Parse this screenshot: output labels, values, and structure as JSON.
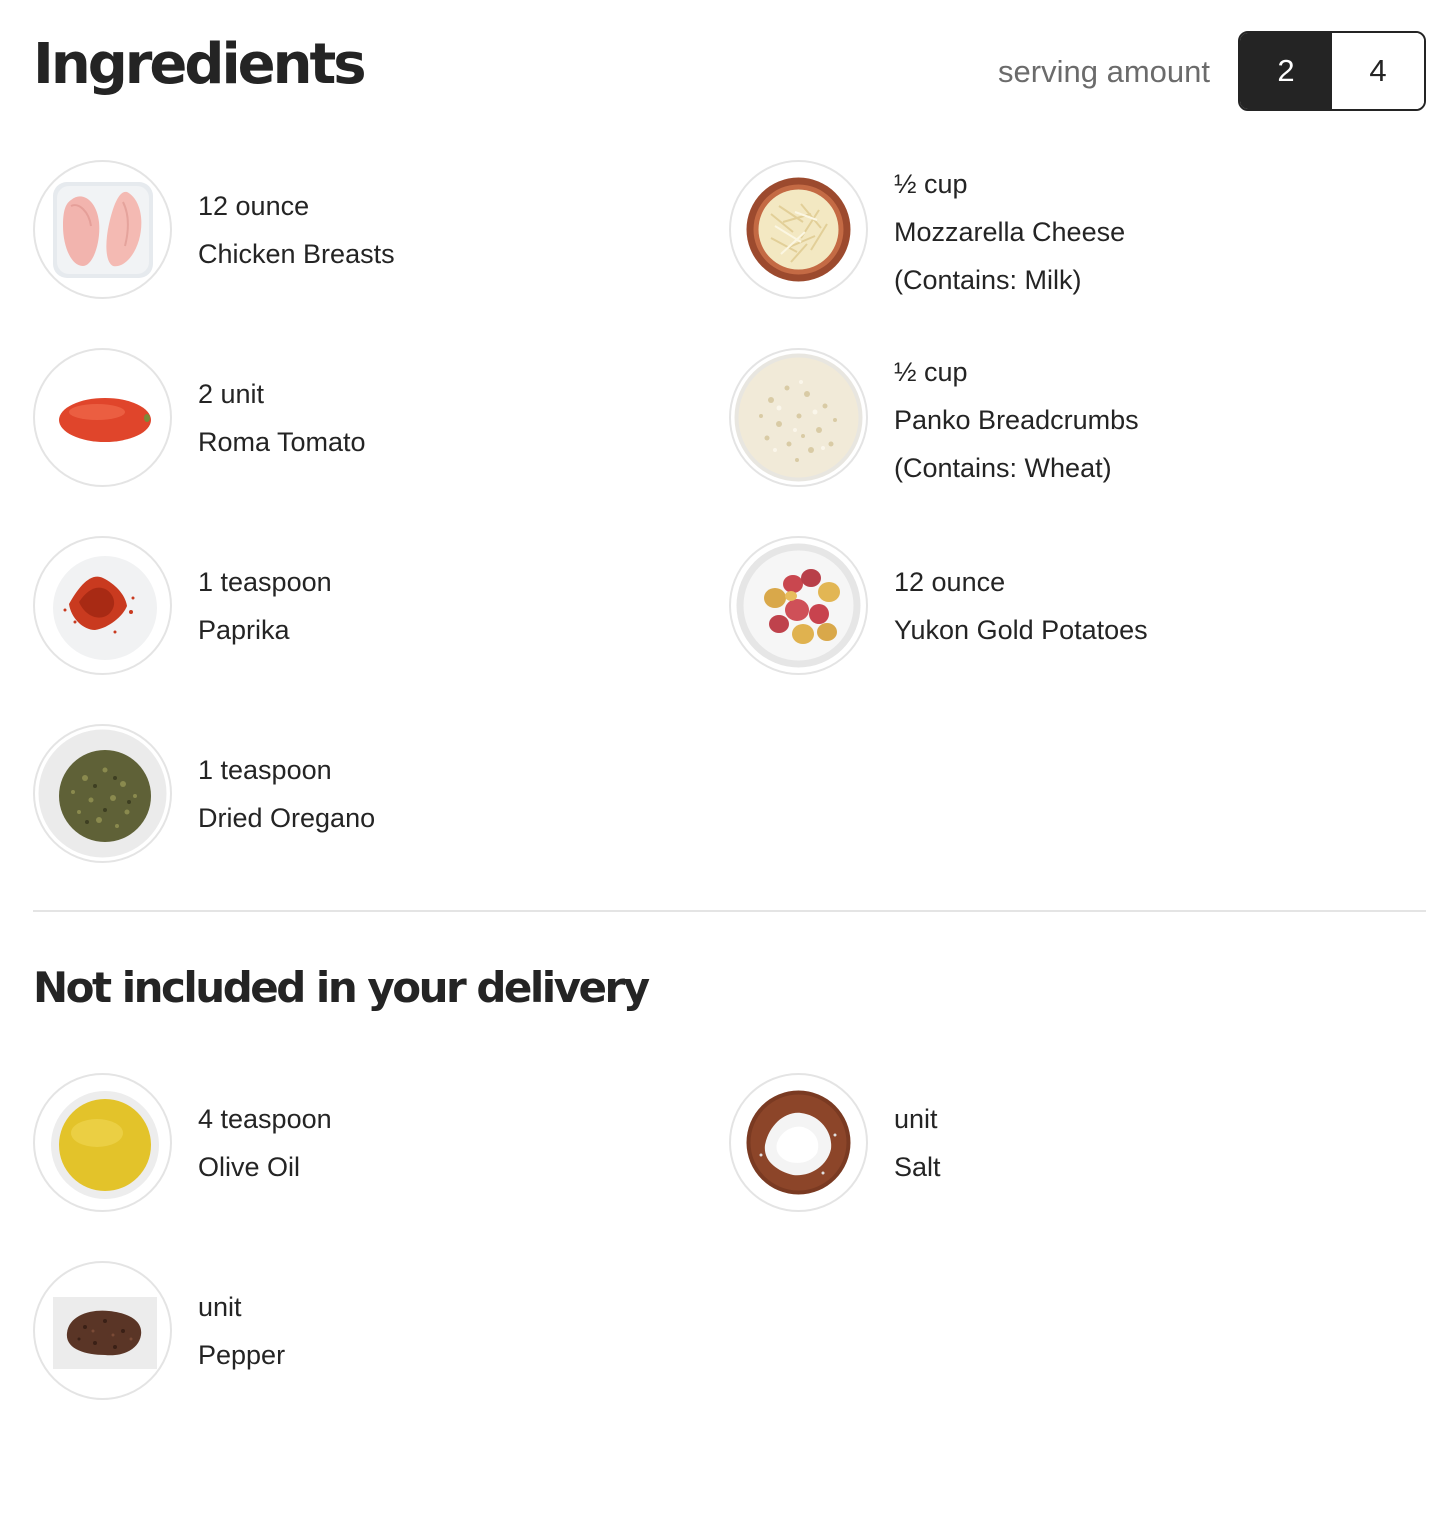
{
  "header": {
    "title": "Ingredients",
    "serving_label": "serving amount",
    "serving_options": [
      "2",
      "4"
    ],
    "serving_selected": "2"
  },
  "ingredients": [
    {
      "amount": "12 ounce",
      "name": "Chicken Breasts",
      "image": "chicken-breasts-image"
    },
    {
      "amount": "½ cup",
      "name": "Mozzarella Cheese",
      "allergen": "(Contains: Milk)",
      "image": "mozzarella-cheese-image"
    },
    {
      "amount": "2 unit",
      "name": "Roma Tomato",
      "image": "roma-tomato-image"
    },
    {
      "amount": "½ cup",
      "name": "Panko Breadcrumbs",
      "allergen": "(Contains: Wheat)",
      "image": "panko-breadcrumbs-image"
    },
    {
      "amount": "1 teaspoon",
      "name": "Paprika",
      "image": "paprika-image"
    },
    {
      "amount": "12 ounce",
      "name": "Yukon Gold Potatoes",
      "image": "yukon-gold-potatoes-image"
    },
    {
      "amount": "1 teaspoon",
      "name": "Dried Oregano",
      "image": "dried-oregano-image"
    }
  ],
  "not_included": {
    "title": "Not included in your delivery",
    "items": [
      {
        "amount": "4 teaspoon",
        "name": "Olive Oil",
        "image": "olive-oil-image"
      },
      {
        "amount": "unit",
        "name": "Salt",
        "image": "salt-image"
      },
      {
        "amount": "unit",
        "name": "Pepper",
        "image": "pepper-image"
      }
    ]
  },
  "colors": {
    "text": "#242424",
    "muted": "#6b6b6b",
    "border": "#e4e4e4",
    "toggle_active_bg": "#242424"
  }
}
